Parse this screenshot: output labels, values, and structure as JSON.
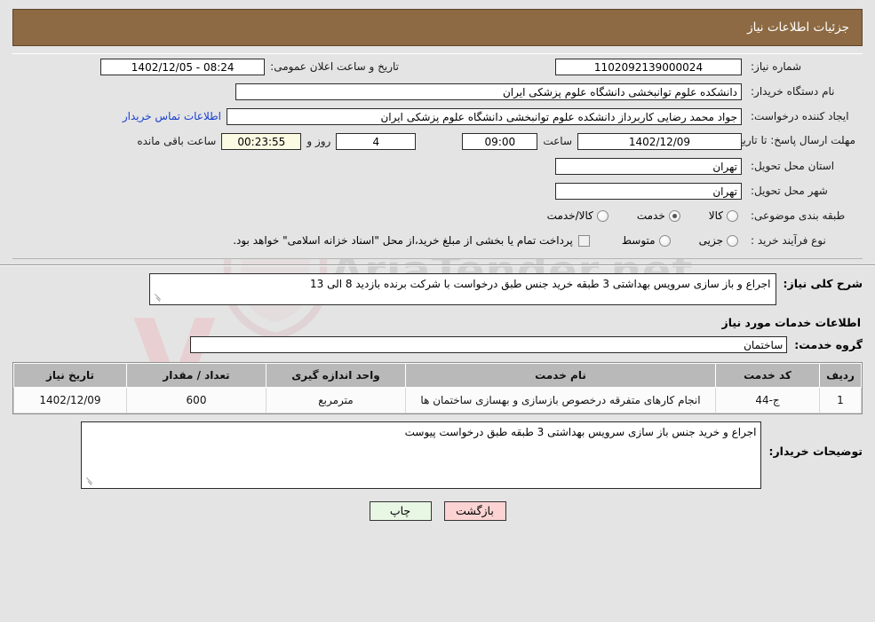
{
  "header": {
    "title": "جزئیات اطلاعات نیاز"
  },
  "details": {
    "need_number_label": "شماره نیاز:",
    "need_number_value": "1102092139000024",
    "public_announce_label": "تاریخ و ساعت اعلان عمومی:",
    "public_announce_value": "08:24 - 1402/12/05",
    "buyer_org_label": "نام دستگاه خریدار:",
    "buyer_org_value": "دانشکده علوم توانبخشی دانشگاه علوم پزشکی ایران",
    "creator_label": "ایجاد کننده درخواست:",
    "creator_value": "جواد محمد رضایی کاربرداز دانشکده علوم توانبخشی دانشگاه علوم پزشکی ایران",
    "contact_link": "اطلاعات تماس خریدار",
    "deadline_label": "مهلت ارسال پاسخ: تا تاریخ:",
    "deadline_date": "1402/12/09",
    "deadline_hour_label": "ساعت",
    "deadline_time": "09:00",
    "remaining_days": "4",
    "remaining_days_label": "روز و",
    "remaining_timer": "00:23:55",
    "remaining_hours_label": "ساعت باقی مانده",
    "province_label": "استان محل تحویل:",
    "province_value": "تهران",
    "city_label": "شهر محل تحویل:",
    "city_value": "تهران",
    "category_label": "طبقه بندی موضوعی:",
    "category_options": [
      {
        "label": "کالا",
        "selected": false
      },
      {
        "label": "خدمت",
        "selected": true
      },
      {
        "label": "کالا/خدمت",
        "selected": false
      }
    ],
    "process_label": "نوع فرآیند خرید :",
    "process_options": [
      {
        "label": "جزیی",
        "selected": false
      },
      {
        "label": "متوسط",
        "selected": false
      }
    ],
    "treasury_note": "پرداخت تمام یا بخشی از مبلغ خرید،از محل \"اسناد خزانه اسلامی\" خواهد بود."
  },
  "need_desc": {
    "label": "شرح کلی نیاز:",
    "value": "اجراع و باز سازی سرویس بهداشتی 3 طبقه خرید جنس طبق درخواست با شرکت برنده بازدید 8 الی 13"
  },
  "services": {
    "heading": "اطلاعات خدمات مورد نیاز",
    "group_label": "گروه خدمت:",
    "group_value": "ساختمان",
    "columns": [
      "ردیف",
      "کد خدمت",
      "نام خدمت",
      "واحد اندازه گیری",
      "تعداد / مقدار",
      "تاریخ نیاز"
    ],
    "rows": [
      {
        "radif": "1",
        "code": "ج-44",
        "name": "انجام کارهای متفرقه درخصوص بازسازی و بهسازی ساختمان ها",
        "unit": "مترمربع",
        "qty": "600",
        "date": "1402/12/09"
      }
    ]
  },
  "buyer_notes": {
    "label": "توضیحات خریدار:",
    "value": "اجراع و خرید جنس باز سازی سرویس بهداشتی 3 طبقه طبق درخواست پیوست"
  },
  "footer": {
    "back_label": "بازگشت",
    "print_label": "چاپ"
  },
  "watermark": {
    "brand": "AriaTender.net",
    "letter": "V"
  },
  "colors": {
    "header_bg": "#8d6a43",
    "page_bg": "#e4e4e4",
    "link": "#1a3fd0",
    "table_header_bg": "#b9b9b9",
    "timer_bg": "#fbfbe3",
    "btn_back_bg": "#fbd3d3",
    "btn_print_bg": "#e8f6e4"
  }
}
